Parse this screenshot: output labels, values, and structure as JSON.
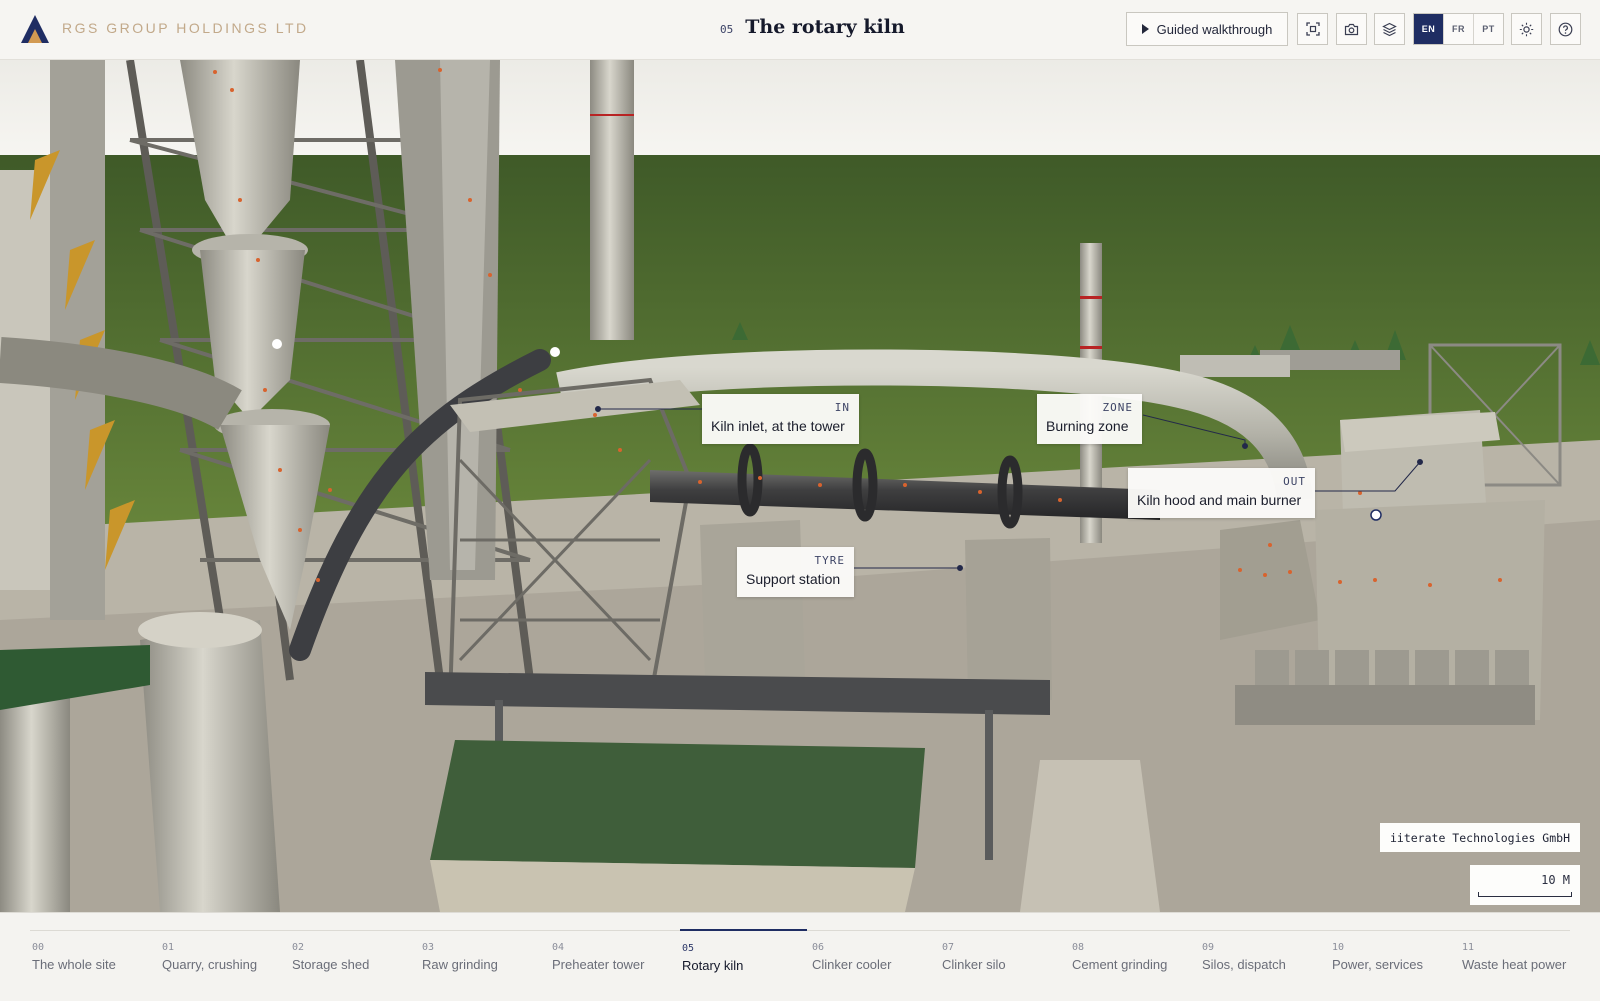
{
  "header": {
    "brand": "RGS GROUP HOLDINGS LTD",
    "section_number": "05",
    "title": "The rotary kiln",
    "walkthrough_label": "Guided walkthrough",
    "icons": [
      "play-icon",
      "focus-frame-icon",
      "camera-icon",
      "layers-icon",
      "sun-icon",
      "help-icon"
    ],
    "languages": [
      {
        "code": "EN",
        "active": true
      },
      {
        "code": "FR",
        "active": false
      },
      {
        "code": "PT",
        "active": false
      }
    ]
  },
  "callouts": {
    "inlet": {
      "tag": "IN",
      "text": "Kiln inlet, at the tower"
    },
    "burning": {
      "tag": "ZONE",
      "text": "Burning zone"
    },
    "hood": {
      "tag": "OUT",
      "text": "Kiln hood and main burner"
    },
    "tyre": {
      "tag": "TYRE",
      "text": "Support station"
    }
  },
  "credit": "iiterate Technologies GmbH",
  "scale": {
    "value": "10 M"
  },
  "nav": {
    "active_index": 5,
    "items": [
      {
        "num": "00",
        "label": "The whole site"
      },
      {
        "num": "01",
        "label": "Quarry, crushing"
      },
      {
        "num": "02",
        "label": "Storage shed"
      },
      {
        "num": "03",
        "label": "Raw grinding"
      },
      {
        "num": "04",
        "label": "Preheater tower"
      },
      {
        "num": "05",
        "label": "Rotary kiln"
      },
      {
        "num": "06",
        "label": "Clinker cooler"
      },
      {
        "num": "07",
        "label": "Clinker silo"
      },
      {
        "num": "08",
        "label": "Cement grinding"
      },
      {
        "num": "09",
        "label": "Silos, dispatch"
      },
      {
        "num": "10",
        "label": "Power, services"
      },
      {
        "num": "11",
        "label": "Waste heat power"
      }
    ]
  },
  "colors": {
    "accent": "#1f2d63",
    "brand_text": "#c2a98a",
    "particle": "#d8632e"
  }
}
